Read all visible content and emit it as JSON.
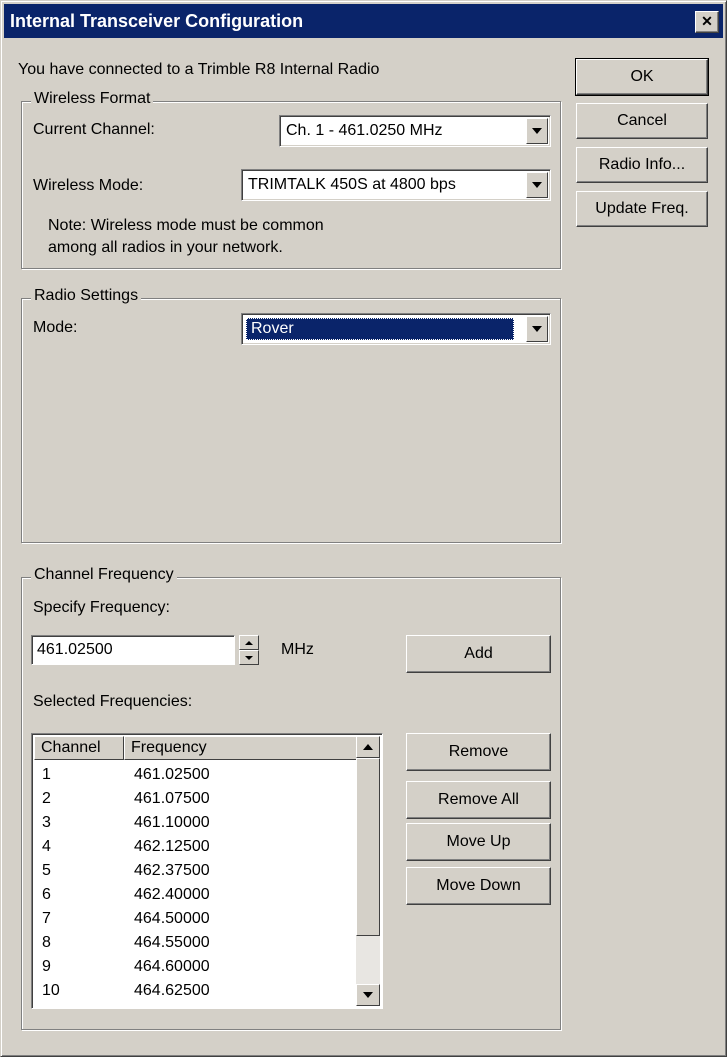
{
  "window": {
    "title": "Internal Transceiver Configuration",
    "close_glyph": "✕"
  },
  "intro_text": "You have connected to a Trimble R8 Internal Radio",
  "buttons": {
    "ok": "OK",
    "cancel": "Cancel",
    "radio_info": "Radio Info...",
    "update_freq": "Update Freq."
  },
  "wireless_format": {
    "legend": "Wireless Format",
    "current_channel_label": "Current Channel:",
    "current_channel_value": "Ch.  1 - 461.0250 MHz",
    "wireless_mode_label": "Wireless Mode:",
    "wireless_mode_value": "TRIMTALK 450S at 4800 bps",
    "note_line1": "Note: Wireless mode must be common",
    "note_line2": "among all radios in your network."
  },
  "radio_settings": {
    "legend": "Radio Settings",
    "mode_label": "Mode:",
    "mode_value": "Rover"
  },
  "channel_frequency": {
    "legend": "Channel Frequency",
    "specify_label": "Specify Frequency:",
    "frequency_value": "461.02500",
    "unit": "MHz",
    "add_button": "Add",
    "selected_label": "Selected Frequencies:",
    "columns": [
      "Channel",
      "Frequency"
    ],
    "rows": [
      {
        "channel": "1",
        "frequency": "461.02500"
      },
      {
        "channel": "2",
        "frequency": "461.07500"
      },
      {
        "channel": "3",
        "frequency": "461.10000"
      },
      {
        "channel": "4",
        "frequency": "462.12500"
      },
      {
        "channel": "5",
        "frequency": "462.37500"
      },
      {
        "channel": "6",
        "frequency": "462.40000"
      },
      {
        "channel": "7",
        "frequency": "464.50000"
      },
      {
        "channel": "8",
        "frequency": "464.55000"
      },
      {
        "channel": "9",
        "frequency": "464.60000"
      },
      {
        "channel": "10",
        "frequency": "464.62500"
      }
    ],
    "remove_button": "Remove",
    "remove_all_button": "Remove All",
    "move_up_button": "Move Up",
    "move_down_button": "Move Down"
  },
  "colors": {
    "titlebar": "#0a246a",
    "face": "#d4d0c8",
    "selection": "#0a246a"
  }
}
